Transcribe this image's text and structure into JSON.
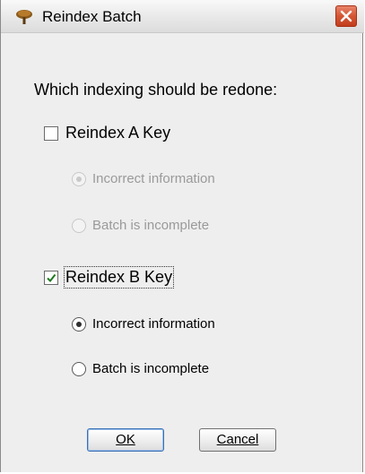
{
  "window": {
    "title": "Reindex Batch"
  },
  "prompt": "Which indexing should be redone:",
  "key_a": {
    "label": "Reindex A Key",
    "checked": false,
    "options": [
      "Incorrect information",
      "Batch is incomplete"
    ]
  },
  "key_b": {
    "label": "Reindex B Key",
    "checked": true,
    "options": [
      "Incorrect information",
      "Batch is incomplete"
    ]
  },
  "buttons": {
    "ok": "OK",
    "cancel": "Cancel"
  }
}
